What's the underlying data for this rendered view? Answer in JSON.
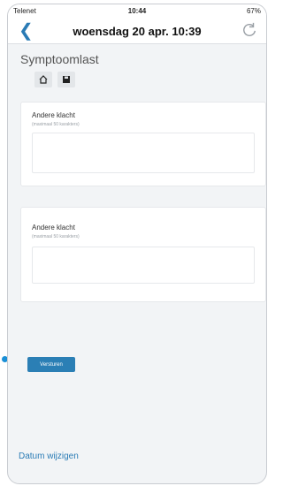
{
  "status_bar": {
    "carrier": "Telenet",
    "time": "10:44",
    "battery": "67%"
  },
  "nav": {
    "back_icon": "chevron-left-icon",
    "title": "woensdag 20 apr. 10:39",
    "refresh_icon": "refresh-icon"
  },
  "page": {
    "title": "Symptoomlast",
    "home_icon": "home-icon",
    "save_icon": "save-icon"
  },
  "fields": [
    {
      "label": "Andere klacht",
      "hint": "(maximaal 50 karakters)",
      "value": ""
    },
    {
      "label": "Andere klacht",
      "hint": "(maximaal 50 karakters)",
      "value": ""
    }
  ],
  "actions": {
    "submit_label": "Versturen",
    "change_date_label": "Datum wijzigen"
  },
  "colors": {
    "accent": "#2b7fb5",
    "indicator": "#1a8fd6"
  }
}
